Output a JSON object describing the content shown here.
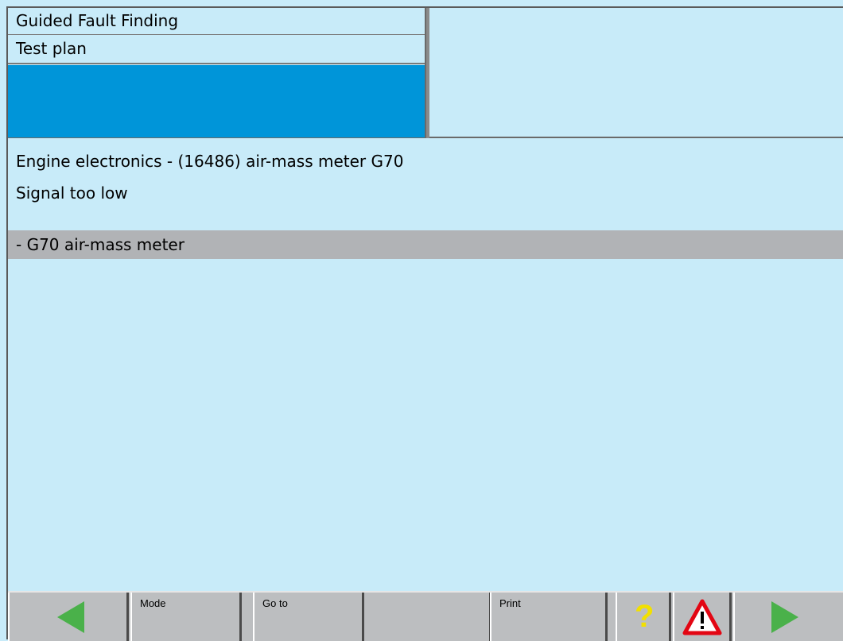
{
  "header": {
    "title": "Guided Fault Finding",
    "subtitle": "Test plan"
  },
  "content": {
    "line1": "Engine electronics - (16486) air-mass meter G70",
    "line2": "Signal too low",
    "selected_item": "- G70 air-mass meter"
  },
  "toolbar": {
    "back_icon": "left-arrow-icon",
    "mode_label": "Mode",
    "goto_label": "Go to",
    "print_label": "Print",
    "help_icon": "question-mark-icon",
    "warning_icon": "warning-triangle-icon",
    "next_icon": "right-arrow-icon"
  },
  "colors": {
    "background": "#c8ebf9",
    "accent_blue": "#0095d9",
    "selection_gray": "#b1b3b6",
    "arrow_green": "#4ab14a",
    "help_yellow": "#f2e000",
    "warning_red": "#e30613"
  }
}
